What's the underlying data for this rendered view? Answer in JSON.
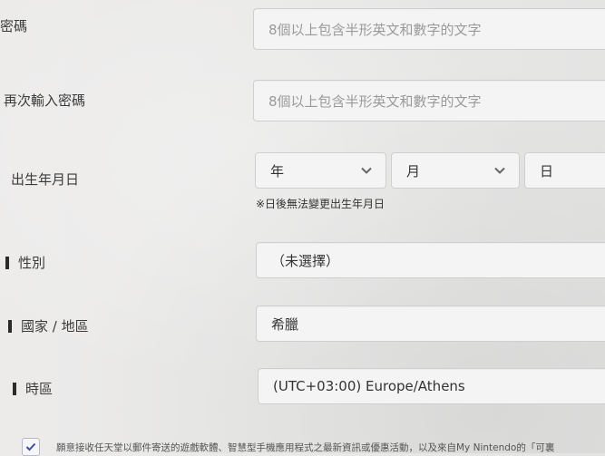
{
  "form": {
    "password": {
      "label": "密碼",
      "placeholder": "8個以上包含半形英文和數字的文字"
    },
    "password_confirm": {
      "label": "再次輸入密碼",
      "placeholder": "8個以上包含半形英文和數字的文字"
    },
    "birthdate": {
      "label": "出生年月日",
      "year": "年",
      "month": "月",
      "day": "日",
      "note": "※日後無法變更出生年月日"
    },
    "gender": {
      "label": "性別",
      "value": "（未選擇）"
    },
    "country": {
      "label": "國家 / 地區",
      "value": "希臘"
    },
    "timezone": {
      "label": "時區",
      "value": "(UTC+03:00) Europe/Athens"
    },
    "consent": {
      "text": "願意接收任天堂以郵件寄送的遊戲軟體、智慧型手機應用程式之最新資訊或優惠活動，以及來自My Nintendo的「可裏",
      "checked": true
    }
  },
  "colors": {
    "accent": "#3c4fa0",
    "field_bg": "#f4f4f4",
    "border": "#cfcfcf"
  },
  "icons": {
    "select_arrow": "chevron-down-icon",
    "checkbox_mark": "checkmark-icon"
  }
}
